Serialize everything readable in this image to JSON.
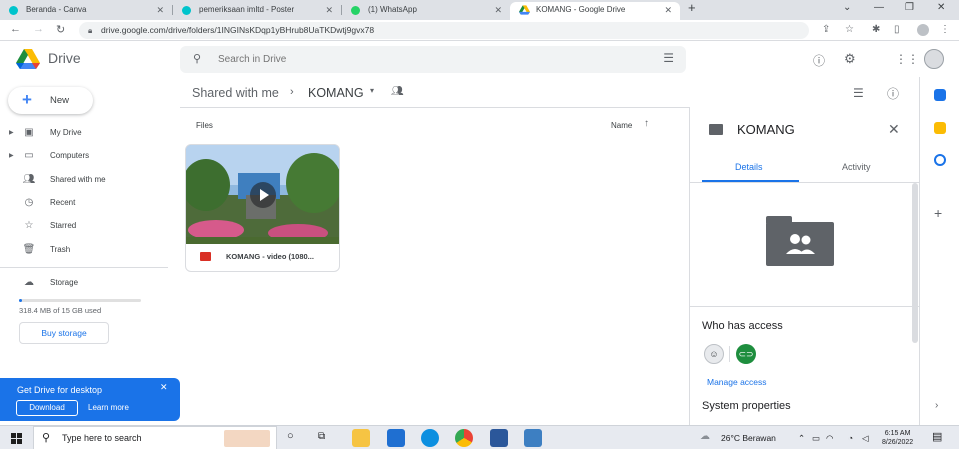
{
  "browser": {
    "tabs": [
      {
        "title": "Beranda - Canva",
        "favicon_color": "#00c4cc",
        "active": false
      },
      {
        "title": "pemeriksaan imltd - Poster",
        "favicon_color": "#00c4cc",
        "active": false
      },
      {
        "title": "(1) WhatsApp",
        "favicon_color": "#25d366",
        "active": false
      },
      {
        "title": "KOMANG - Google Drive",
        "favicon_color": "#fbbc04",
        "active": true
      }
    ],
    "new_tab": "+",
    "url": "drive.google.com/drive/folders/1INGINsKDqp1yBHrub8UaTKDwtj9gvx78"
  },
  "header": {
    "app_name": "Drive",
    "search_placeholder": "Search in Drive"
  },
  "sidebar": {
    "new_label": "New",
    "items": [
      {
        "label": "My Drive",
        "icon": "my-drive-icon",
        "expandable": true
      },
      {
        "label": "Computers",
        "icon": "computers-icon",
        "expandable": true
      },
      {
        "label": "Shared with me",
        "icon": "shared-icon",
        "expandable": false
      },
      {
        "label": "Recent",
        "icon": "clock-icon",
        "expandable": false
      },
      {
        "label": "Starred",
        "icon": "star-icon",
        "expandable": false
      },
      {
        "label": "Trash",
        "icon": "trash-icon",
        "expandable": false
      }
    ],
    "storage_label": "Storage",
    "storage_used_text": "318.4 MB of 15 GB used",
    "storage_fraction": 0.0207,
    "buy_storage": "Buy storage"
  },
  "promo": {
    "title": "Get Drive for desktop",
    "download": "Download",
    "learn_more": "Learn more"
  },
  "main": {
    "breadcrumb_parent": "Shared with me",
    "breadcrumb_current": "KOMANG",
    "files_label": "Files",
    "sort_label": "Name",
    "file": {
      "name": "KOMANG - video (1080...",
      "type_icon": "video-file-icon"
    }
  },
  "details": {
    "title": "KOMANG",
    "tab_details": "Details",
    "tab_activity": "Activity",
    "who_has_access": "Who has access",
    "manage_access": "Manage access",
    "system_properties": "System properties"
  },
  "taskbar": {
    "search_placeholder": "Type here to search",
    "weather": "26°C  Berawan",
    "time": "6:15 AM",
    "date": "8/26/2022"
  },
  "colors": {
    "accent": "#1a73e8",
    "promo_bg": "#1a73e8",
    "folder_icon": "#5f6368"
  }
}
